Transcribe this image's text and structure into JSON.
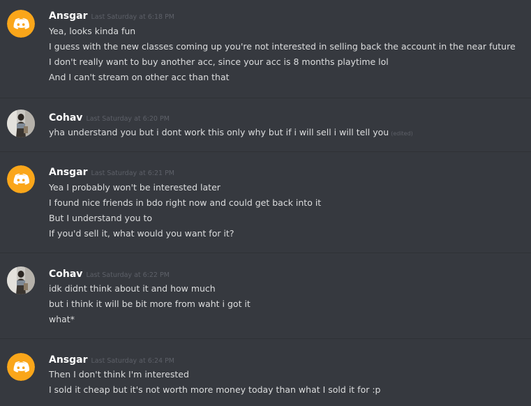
{
  "messages": [
    {
      "author": "Ansgar",
      "avatar": "discord-logo-icon",
      "timestamp": "Last Saturday at 6:18 PM",
      "lines": [
        "Yea, looks kinda fun",
        "I guess with the new classes coming up you're not interested in selling back the account in the near future",
        "I don't really want to buy another acc, since your acc is 8 months playtime lol",
        "And I can't stream on other acc than that"
      ]
    },
    {
      "author": "Cohav",
      "avatar": "user-photo-avatar",
      "timestamp": "Last Saturday at 6:20 PM",
      "lines": [
        "yha understand you but i dont work this only why but if i will sell i will tell you"
      ],
      "edited_label": "(edited)"
    },
    {
      "author": "Ansgar",
      "avatar": "discord-logo-icon",
      "timestamp": "Last Saturday at 6:21 PM",
      "lines": [
        "Yea I probably won't be interested later",
        "I found nice friends in bdo right now and could get back into it",
        "But I understand you to",
        "If you'd sell it, what would you want for it?"
      ]
    },
    {
      "author": "Cohav",
      "avatar": "user-photo-avatar",
      "timestamp": "Last Saturday at 6:22 PM",
      "lines": [
        "idk didnt think about it and how much",
        "but i think it will be bit more from waht i got it",
        "what*"
      ]
    },
    {
      "author": "Ansgar",
      "avatar": "discord-logo-icon",
      "timestamp": "Last Saturday at 6:24 PM",
      "lines": [
        "Then I don't think I'm interested",
        "I sold it cheap but it's not worth more money today than what I sold it for :p"
      ]
    }
  ],
  "colors": {
    "background": "#36393f",
    "divider": "#2f3136",
    "discord_avatar": "#faa61a",
    "username": "#ffffff",
    "message_text": "#dcddde",
    "timestamp": "#5d6068"
  }
}
